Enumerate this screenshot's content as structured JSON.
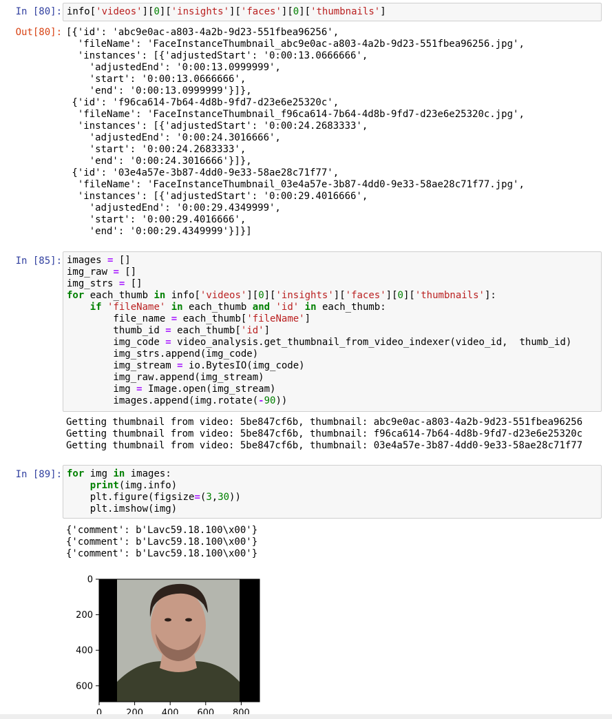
{
  "cells": [
    {
      "in_prompt": "In [80]:",
      "code": "info['videos'][0]['insights']['faces'][0]['thumbnails']",
      "out_prompt": "Out[80]:",
      "output": "[{'id': 'abc9e0ac-a803-4a2b-9d23-551fbea96256',\n  'fileName': 'FaceInstanceThumbnail_abc9e0ac-a803-4a2b-9d23-551fbea96256.jpg',\n  'instances': [{'adjustedStart': '0:00:13.0666666',\n    'adjustedEnd': '0:00:13.0999999',\n    'start': '0:00:13.0666666',\n    'end': '0:00:13.0999999'}]},\n {'id': 'f96ca614-7b64-4d8b-9fd7-d23e6e25320c',\n  'fileName': 'FaceInstanceThumbnail_f96ca614-7b64-4d8b-9fd7-d23e6e25320c.jpg',\n  'instances': [{'adjustedStart': '0:00:24.2683333',\n    'adjustedEnd': '0:00:24.3016666',\n    'start': '0:00:24.2683333',\n    'end': '0:00:24.3016666'}]},\n {'id': '03e4a57e-3b87-4dd0-9e33-58ae28c71f77',\n  'fileName': 'FaceInstanceThumbnail_03e4a57e-3b87-4dd0-9e33-58ae28c71f77.jpg',\n  'instances': [{'adjustedStart': '0:00:29.4016666',\n    'adjustedEnd': '0:00:29.4349999',\n    'start': '0:00:29.4016666',\n    'end': '0:00:29.4349999'}]}]"
    },
    {
      "in_prompt": "In [85]:",
      "code": "images = []\nimg_raw = []\nimg_strs = []\nfor each_thumb in info['videos'][0]['insights']['faces'][0]['thumbnails']:\n    if 'fileName' in each_thumb and 'id' in each_thumb:\n        file_name = each_thumb['fileName']\n        thumb_id = each_thumb['id']\n        img_code = video_analysis.get_thumbnail_from_video_indexer(video_id,  thumb_id)\n        img_strs.append(img_code)\n        img_stream = io.BytesIO(img_code)\n        img_raw.append(img_stream)\n        img = Image.open(img_stream)\n        images.append(img.rotate(-90))",
      "output": "Getting thumbnail from video: 5be847cf6b, thumbnail: abc9e0ac-a803-4a2b-9d23-551fbea96256\nGetting thumbnail from video: 5be847cf6b, thumbnail: f96ca614-7b64-4d8b-9fd7-d23e6e25320c\nGetting thumbnail from video: 5be847cf6b, thumbnail: 03e4a57e-3b87-4dd0-9e33-58ae28c71f77"
    },
    {
      "in_prompt": "In [89]:",
      "code": "for img in images:\n    print(img.info)\n    plt.figure(figsize=(3,30))\n    plt.imshow(img)",
      "output": "{'comment': b'Lavc59.18.100\\x00'}\n{'comment': b'Lavc59.18.100\\x00'}\n{'comment': b'Lavc59.18.100\\x00'}"
    }
  ],
  "plot": {
    "y_ticks": [
      "0",
      "200",
      "400",
      "600"
    ],
    "x_ticks": [
      "0",
      "200",
      "400",
      "600",
      "800"
    ],
    "colors": {
      "background": "#000000",
      "wall": "#b4b6ae",
      "shirt": "#3b3f2c",
      "skin": "#c79a86",
      "hair": "#2e221c"
    }
  }
}
